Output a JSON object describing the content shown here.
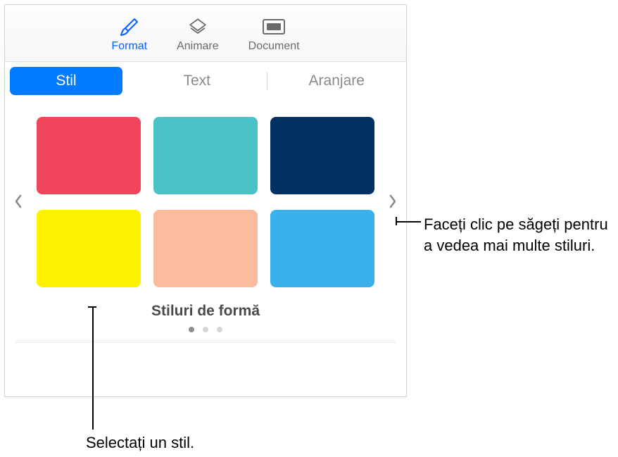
{
  "toolbar": {
    "items": [
      {
        "label": "Format"
      },
      {
        "label": "Animare"
      },
      {
        "label": "Document"
      }
    ]
  },
  "tabs": {
    "items": [
      {
        "label": "Stil"
      },
      {
        "label": "Text"
      },
      {
        "label": "Aranjare"
      }
    ]
  },
  "styles": {
    "title": "Stiluri de formă",
    "swatches": [
      [
        {
          "color": "#f1455c"
        },
        {
          "color": "#4ac3c6"
        },
        {
          "color": "#003162"
        }
      ],
      [
        {
          "color": "#fff200"
        },
        {
          "color": "#fcbb9c"
        },
        {
          "color": "#3bb1eb"
        }
      ]
    ],
    "page_count": 3,
    "active_page": 0
  },
  "callouts": {
    "right": "Faceți clic pe săgeți pentru a vedea mai multe stiluri.",
    "bottom": "Selectați un stil."
  }
}
